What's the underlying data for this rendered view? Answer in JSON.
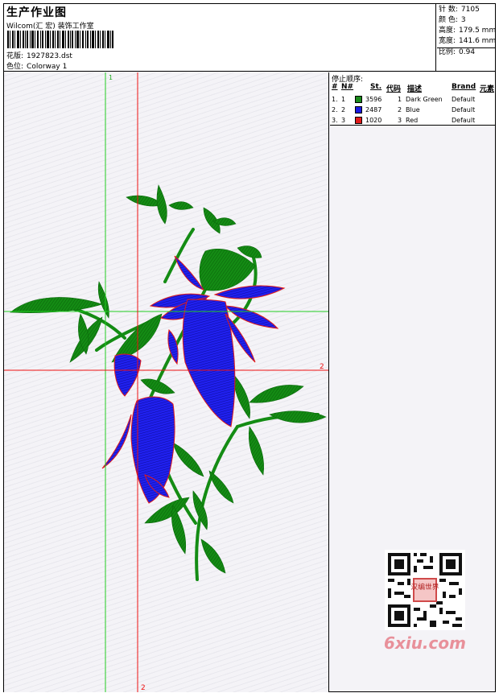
{
  "header": {
    "title": "生产作业图",
    "company": "Wilcom(汇 宏) 装饰工作室",
    "design_label": "花版:",
    "design_value": "1927823.dst",
    "colorway_label": "色位:",
    "colorway_value": "Colorway 1"
  },
  "stats": {
    "stitches_label": "针 数:",
    "stitches_value": "7105",
    "colors_label": "颜 色:",
    "colors_value": "3",
    "height_label": "高度:",
    "height_value": "179.5 mm",
    "width_label": "宽度:",
    "width_value": "141.6 mm",
    "scale_label": "比例:",
    "scale_value": "0.94"
  },
  "stop_sequence": {
    "title": "停止顺序:",
    "columns": [
      "#",
      "N#",
      "St.",
      "代码",
      "描述",
      "Brand",
      "元素"
    ],
    "rows": [
      {
        "idx": "1.",
        "n": "1",
        "color": "#1a8a1a",
        "st": "3596",
        "code": "1",
        "desc": "Dark Green",
        "brand": "Default"
      },
      {
        "idx": "2.",
        "n": "2",
        "color": "#1a1ae0",
        "st": "2487",
        "code": "2",
        "desc": "Blue",
        "brand": "Default"
      },
      {
        "idx": "3.",
        "n": "3",
        "color": "#e01a1a",
        "st": "1020",
        "code": "3",
        "desc": "Red",
        "brand": "Default"
      }
    ]
  },
  "guides": {
    "guide1_label": "1",
    "guide2_label": "2",
    "guide2_bottom_label": "2"
  },
  "colors": {
    "green": "#138a13",
    "blue": "#1b1be6",
    "red": "#e01a1a",
    "guide_green": "#22cc22",
    "guide_red": "#ee1111"
  },
  "watermark": {
    "text": "6xiu.com",
    "badge": "汉编世界",
    "icon": "qr-code-icon"
  }
}
